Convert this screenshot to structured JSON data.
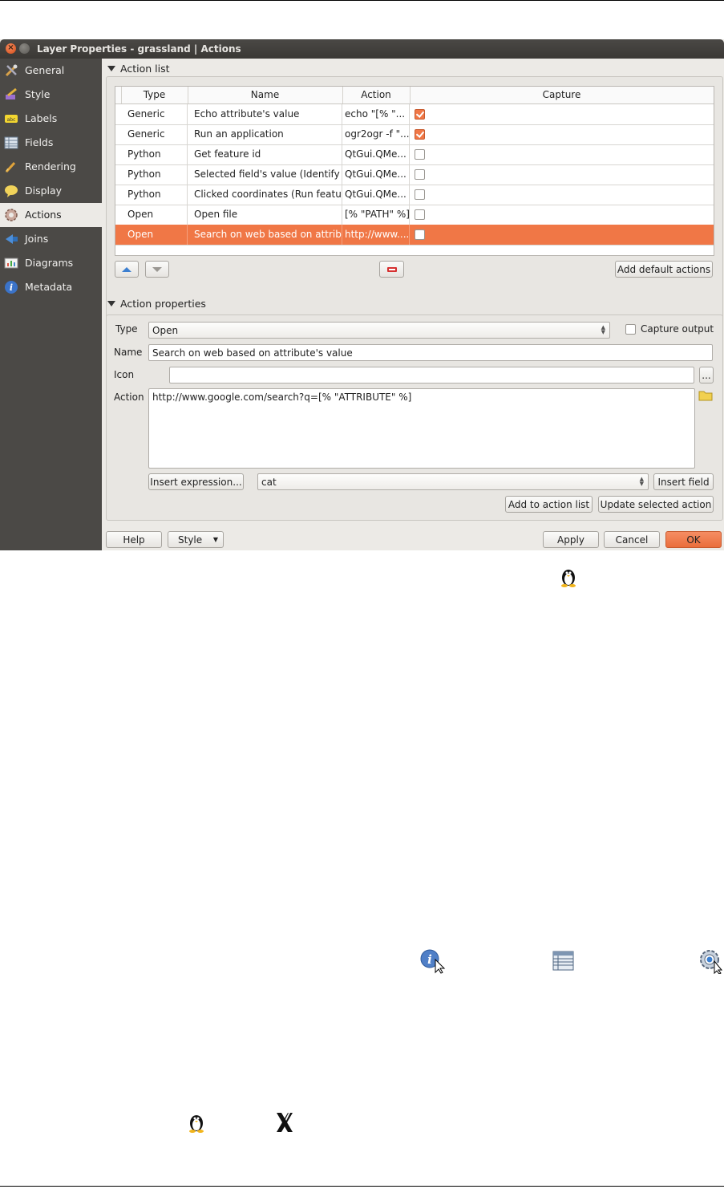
{
  "window": {
    "title": "Layer Properties - grassland | Actions"
  },
  "sidebar": {
    "items": [
      {
        "label": "General",
        "icon": "general-tools-icon"
      },
      {
        "label": "Style",
        "icon": "style-brush-icon"
      },
      {
        "label": "Labels",
        "icon": "labels-abc-icon"
      },
      {
        "label": "Fields",
        "icon": "fields-table-icon"
      },
      {
        "label": "Rendering",
        "icon": "rendering-brush-icon"
      },
      {
        "label": "Display",
        "icon": "display-bubble-icon"
      },
      {
        "label": "Actions",
        "icon": "actions-gear-icon",
        "active": true
      },
      {
        "label": "Joins",
        "icon": "joins-arrow-icon"
      },
      {
        "label": "Diagrams",
        "icon": "diagrams-chart-icon"
      },
      {
        "label": "Metadata",
        "icon": "metadata-info-icon"
      }
    ]
  },
  "action_list": {
    "heading": "Action list",
    "columns": [
      "Type",
      "Name",
      "Action",
      "Capture"
    ],
    "rows": [
      {
        "type": "Generic",
        "name": "Echo attribute's value",
        "action": "echo \"[% \"...",
        "capture": true
      },
      {
        "type": "Generic",
        "name": "Run an application",
        "action": "ogr2ogr -f \"...",
        "capture": true
      },
      {
        "type": "Python",
        "name": "Get feature id",
        "action": "QtGui.QMe...",
        "capture": false
      },
      {
        "type": "Python",
        "name": "Selected field's value (Identify ...",
        "action": "QtGui.QMe...",
        "capture": false
      },
      {
        "type": "Python",
        "name": "Clicked coordinates (Run featu...",
        "action": "QtGui.QMe...",
        "capture": false
      },
      {
        "type": "Open",
        "name": "Open file",
        "action": "[% \"PATH\" %]",
        "capture": false
      },
      {
        "type": "Open",
        "name": "Search on web based on attrib...",
        "action": "http://www....",
        "capture": false,
        "selected": true
      }
    ],
    "add_default_label": "Add default actions"
  },
  "action_properties": {
    "heading": "Action properties",
    "type_label": "Type",
    "type_value": "Open",
    "capture_output_label": "Capture output",
    "name_label": "Name",
    "name_value": "Search on web based on attribute's value",
    "icon_label": "Icon",
    "icon_value": "",
    "browse_label": "...",
    "action_label": "Action",
    "action_value": "http://www.google.com/search?q=[% \"ATTRIBUTE\" %]",
    "insert_expression_label": "Insert expression...",
    "field_combo_value": "cat",
    "insert_field_label": "Insert field",
    "add_to_list_label": "Add to action list",
    "update_selected_label": "Update selected action"
  },
  "footer": {
    "help": "Help",
    "style": "Style",
    "apply": "Apply",
    "cancel": "Cancel",
    "ok": "OK"
  },
  "colors": {
    "accent": "#f07746",
    "sidebar": "#4b4946",
    "dialog_bg": "#eceae6"
  }
}
